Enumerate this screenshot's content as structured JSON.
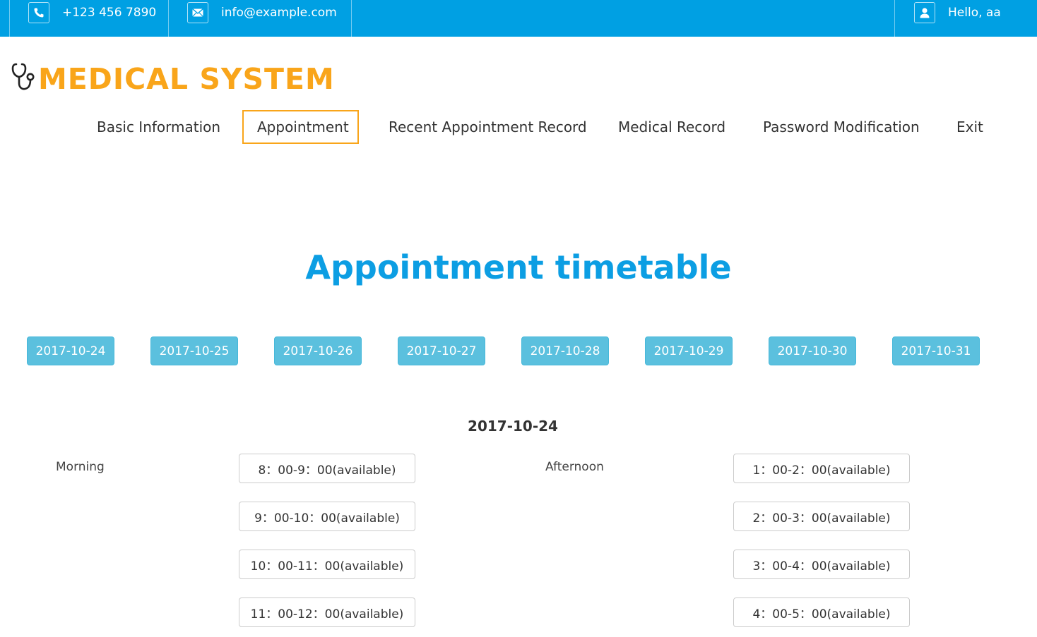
{
  "topbar": {
    "phone": "+123 456 7890",
    "email": "info@example.com",
    "greeting": "Hello, aa",
    "phone_icon": "phone-icon",
    "email_icon": "envelope-icon",
    "user_icon": "user-icon"
  },
  "logo": {
    "text": "MEDICAL SYSTEM",
    "icon": "stethoscope-icon"
  },
  "nav": {
    "basic_info": "Basic Information",
    "appointment": "Appointment",
    "recent": "Recent Appointment Record",
    "medical": "Medical Record",
    "password": "Password Modification",
    "exit": "Exit"
  },
  "title": "Appointment timetable",
  "dates": [
    "2017-10-24",
    "2017-10-25",
    "2017-10-26",
    "2017-10-27",
    "2017-10-28",
    "2017-10-29",
    "2017-10-30",
    "2017-10-31"
  ],
  "selected_date": "2017-10-24",
  "morning": {
    "label": "Morning",
    "slots": [
      "8：00-9：00(available)",
      "9：00-10：00(available)",
      "10：00-11：00(available)",
      "11：00-12：00(available)"
    ]
  },
  "afternoon": {
    "label": "Afternoon",
    "slots": [
      "1：00-2：00(available)",
      "2：00-3：00(available)",
      "3：00-4：00(available)",
      "4：00-5：00(available)"
    ]
  },
  "colors": {
    "topbar": "#00a0e3",
    "logo": "#f9a51a",
    "title": "#0c9ee3",
    "date_button": "#5bc0de",
    "active_nav_border": "#f9a51a"
  }
}
